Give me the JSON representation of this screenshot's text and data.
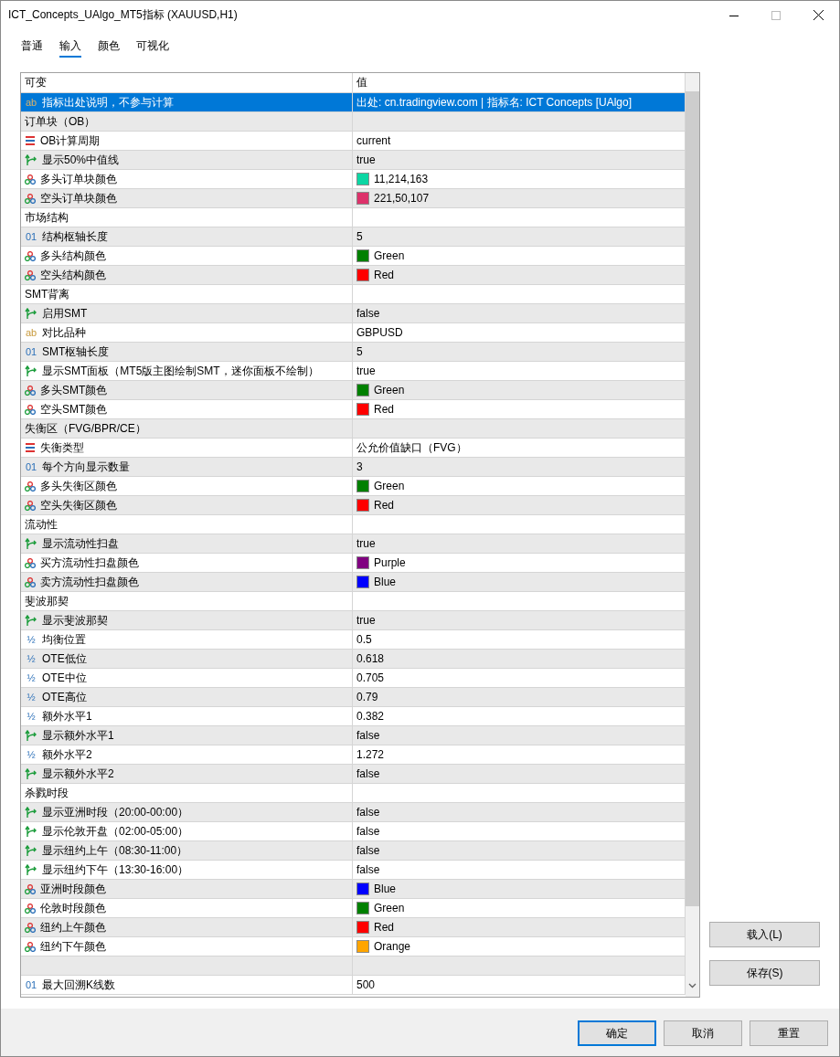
{
  "window": {
    "title": "ICT_Concepts_UAlgo_MT5指标 (XAUUSD,H1)"
  },
  "tabs": [
    {
      "label": "普通",
      "selected": false
    },
    {
      "label": "输入",
      "selected": true
    },
    {
      "label": "颜色",
      "selected": false
    },
    {
      "label": "可视化",
      "selected": false
    }
  ],
  "table": {
    "columns": [
      "可变",
      "值"
    ],
    "rows": [
      {
        "kind": "text",
        "icon": "ab",
        "name": "指标出处说明，不参与计算",
        "value": "出处: cn.tradingview.com | 指标名: ICT Concepts [UAlgo]",
        "selected": true
      },
      {
        "kind": "group",
        "name": "订单块（OB）",
        "selected": false
      },
      {
        "kind": "enum",
        "name": "OB计算周期",
        "value": "current",
        "selected": false
      },
      {
        "kind": "bool",
        "name": "显示50%中值线",
        "value": "true",
        "selected": false
      },
      {
        "kind": "color",
        "name": "多头订单块颜色",
        "value": "11,214,163",
        "color": "#0bd6a3",
        "selected": false
      },
      {
        "kind": "color",
        "name": "空头订单块颜色",
        "value": "221,50,107",
        "color": "#dd326b",
        "selected": false
      },
      {
        "kind": "group",
        "name": "市场结构",
        "selected": false
      },
      {
        "kind": "int",
        "icon": "01",
        "name": "结构枢轴长度",
        "value": "5",
        "selected": false
      },
      {
        "kind": "color",
        "name": "多头结构颜色",
        "value": "Green",
        "color": "#008000",
        "selected": false
      },
      {
        "kind": "color",
        "name": "空头结构颜色",
        "value": "Red",
        "color": "#ff0000",
        "selected": false
      },
      {
        "kind": "group",
        "name": "SMT背离",
        "selected": false
      },
      {
        "kind": "bool",
        "name": "启用SMT",
        "value": "false",
        "selected": false
      },
      {
        "kind": "text",
        "icon": "ab",
        "name": "对比品种",
        "value": "GBPUSD",
        "selected": false
      },
      {
        "kind": "int",
        "icon": "01",
        "name": "SMT枢轴长度",
        "value": "5",
        "selected": false
      },
      {
        "kind": "bool",
        "name": "显示SMT面板（MT5版主图绘制SMT，迷你面板不绘制）",
        "value": "true",
        "selected": false
      },
      {
        "kind": "color",
        "name": "多头SMT颜色",
        "value": "Green",
        "color": "#008000",
        "selected": false
      },
      {
        "kind": "color",
        "name": "空头SMT颜色",
        "value": "Red",
        "color": "#ff0000",
        "selected": false
      },
      {
        "kind": "group",
        "name": "失衡区（FVG/BPR/CE）",
        "selected": false
      },
      {
        "kind": "enum",
        "name": "失衡类型",
        "value": "公允价值缺口（FVG）",
        "selected": false
      },
      {
        "kind": "int",
        "icon": "01",
        "name": "每个方向显示数量",
        "value": "3",
        "selected": false
      },
      {
        "kind": "color",
        "name": "多头失衡区颜色",
        "value": "Green",
        "color": "#008000",
        "selected": false
      },
      {
        "kind": "color",
        "name": "空头失衡区颜色",
        "value": "Red",
        "color": "#ff0000",
        "selected": false
      },
      {
        "kind": "group",
        "name": "流动性",
        "selected": false
      },
      {
        "kind": "bool",
        "name": "显示流动性扫盘",
        "value": "true",
        "selected": false
      },
      {
        "kind": "color",
        "name": "买方流动性扫盘颜色",
        "value": "Purple",
        "color": "#800080",
        "selected": false
      },
      {
        "kind": "color",
        "name": "卖方流动性扫盘颜色",
        "value": "Blue",
        "color": "#0000ff",
        "selected": false
      },
      {
        "kind": "group",
        "name": "斐波那契",
        "selected": false
      },
      {
        "kind": "bool",
        "name": "显示斐波那契",
        "value": "true",
        "selected": false
      },
      {
        "kind": "double",
        "icon": "½",
        "name": "均衡位置",
        "value": "0.5",
        "selected": false
      },
      {
        "kind": "double",
        "icon": "½",
        "name": "OTE低位",
        "value": "0.618",
        "selected": false
      },
      {
        "kind": "double",
        "icon": "½",
        "name": "OTE中位",
        "value": "0.705",
        "selected": false
      },
      {
        "kind": "double",
        "icon": "½",
        "name": "OTE高位",
        "value": "0.79",
        "selected": false
      },
      {
        "kind": "double",
        "icon": "½",
        "name": "额外水平1",
        "value": "0.382",
        "selected": false
      },
      {
        "kind": "bool",
        "name": "显示额外水平1",
        "value": "false",
        "selected": false
      },
      {
        "kind": "double",
        "icon": "½",
        "name": "额外水平2",
        "value": "1.272",
        "selected": false
      },
      {
        "kind": "bool",
        "name": "显示额外水平2",
        "value": "false",
        "selected": false
      },
      {
        "kind": "group",
        "name": "杀戮时段",
        "selected": false
      },
      {
        "kind": "bool",
        "name": "显示亚洲时段（20:00-00:00）",
        "value": "false",
        "selected": false
      },
      {
        "kind": "bool",
        "name": "显示伦敦开盘（02:00-05:00）",
        "value": "false",
        "selected": false
      },
      {
        "kind": "bool",
        "name": "显示纽约上午（08:30-11:00）",
        "value": "false",
        "selected": false
      },
      {
        "kind": "bool",
        "name": "显示纽约下午（13:30-16:00）",
        "value": "false",
        "selected": false
      },
      {
        "kind": "color",
        "name": "亚洲时段颜色",
        "value": "Blue",
        "color": "#0000ff",
        "selected": false
      },
      {
        "kind": "color",
        "name": "伦敦时段颜色",
        "value": "Green",
        "color": "#008000",
        "selected": false
      },
      {
        "kind": "color",
        "name": "纽约上午颜色",
        "value": "Red",
        "color": "#ff0000",
        "selected": false
      },
      {
        "kind": "color",
        "name": "纽约下午颜色",
        "value": "Orange",
        "color": "#ffa500",
        "selected": false
      },
      {
        "kind": "blank",
        "selected": false
      },
      {
        "kind": "int",
        "icon": "01",
        "name": "最大回溯K线数",
        "value": "500",
        "selected": false
      }
    ]
  },
  "side_buttons": [
    "载入(L)",
    "保存(S)"
  ],
  "dialog_buttons": [
    {
      "label": "确定",
      "default": true
    },
    {
      "label": "取消",
      "default": false
    },
    {
      "label": "重置",
      "default": false
    }
  ]
}
